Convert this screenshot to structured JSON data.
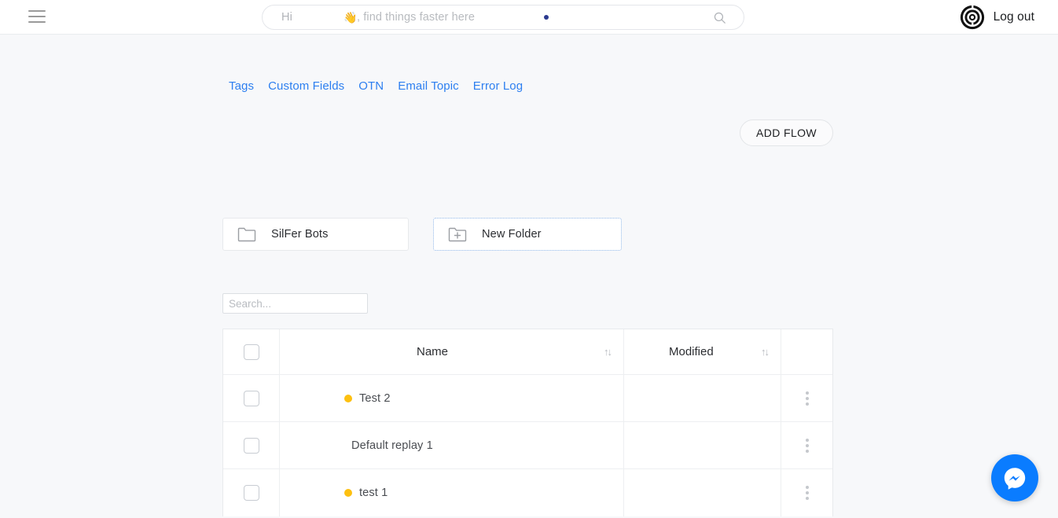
{
  "header": {
    "menu_icon": "hamburger-menu-icon",
    "search": {
      "greeting": "Hi",
      "wave_emoji": "👋",
      "hint": ", find things faster here",
      "placeholder": "Hi 👋, find things faster here",
      "icon": "search-icon",
      "dot_color": "#2b3a8f"
    },
    "logo_icon": "spiral-logo-icon",
    "logout_label": "Log out"
  },
  "nav": {
    "links": [
      {
        "label": "Tags"
      },
      {
        "label": "Custom Fields"
      },
      {
        "label": "OTN"
      },
      {
        "label": "Email Topic"
      },
      {
        "label": "Error Log"
      }
    ],
    "link_color": "#2d7ff0"
  },
  "toolbar": {
    "add_flow_label": "ADD FLOW"
  },
  "folders": [
    {
      "label": "SilFer Bots",
      "icon": "folder-icon",
      "selected": false
    },
    {
      "label": "New Folder",
      "icon": "folder-plus-icon",
      "selected": true
    }
  ],
  "table": {
    "search_placeholder": "Search...",
    "search_value": "",
    "columns": [
      {
        "key": "check",
        "label": ""
      },
      {
        "key": "name",
        "label": "Name",
        "sort_icon": "↑↓"
      },
      {
        "key": "modified",
        "label": "Modified",
        "sort_icon": "↑↓"
      }
    ],
    "rows": [
      {
        "name": "Test 2",
        "status_color": "#fdc010",
        "has_status": true,
        "modified": ""
      },
      {
        "name": "Default replay 1",
        "status_color": "",
        "has_status": false,
        "modified": ""
      },
      {
        "name": "test 1",
        "status_color": "#fdc010",
        "has_status": true,
        "modified": ""
      }
    ],
    "row_menu_icon": "kebab-menu-icon"
  },
  "chat_widget": {
    "icon": "messenger-icon",
    "color": "#0a7cff"
  }
}
